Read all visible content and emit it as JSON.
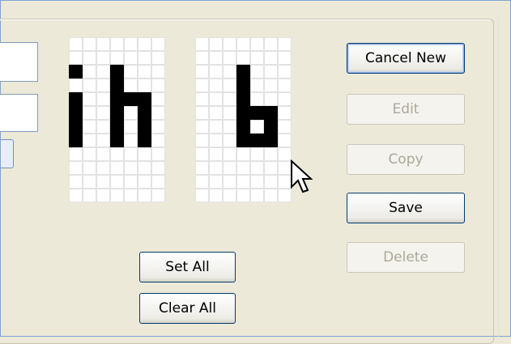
{
  "glyphs": {
    "left_rows": [
      "0000000",
      "0000000",
      "1001000",
      "0001000",
      "1001110",
      "1001010",
      "1001010",
      "1001010",
      "0000000",
      "0000000",
      "0000000",
      "0000000"
    ],
    "right_rows": [
      "0000000",
      "0000000",
      "0001000",
      "0001000",
      "0001000",
      "0001110",
      "0001010",
      "0001110",
      "0000000",
      "0000000",
      "0000000",
      "0000000"
    ]
  },
  "buttons": {
    "cancel_new": "Cancel New",
    "edit": "Edit",
    "copy": "Copy",
    "save": "Save",
    "delete": "Delete",
    "set_all": "Set All",
    "clear_all": "Clear All"
  },
  "colors": {
    "pixel_on": "#000000",
    "pixel_off": "#ffffff",
    "button_border": "#003c74",
    "disabled_text": "#aca899"
  },
  "icons": {
    "cursor": "arrow-cursor-icon"
  }
}
